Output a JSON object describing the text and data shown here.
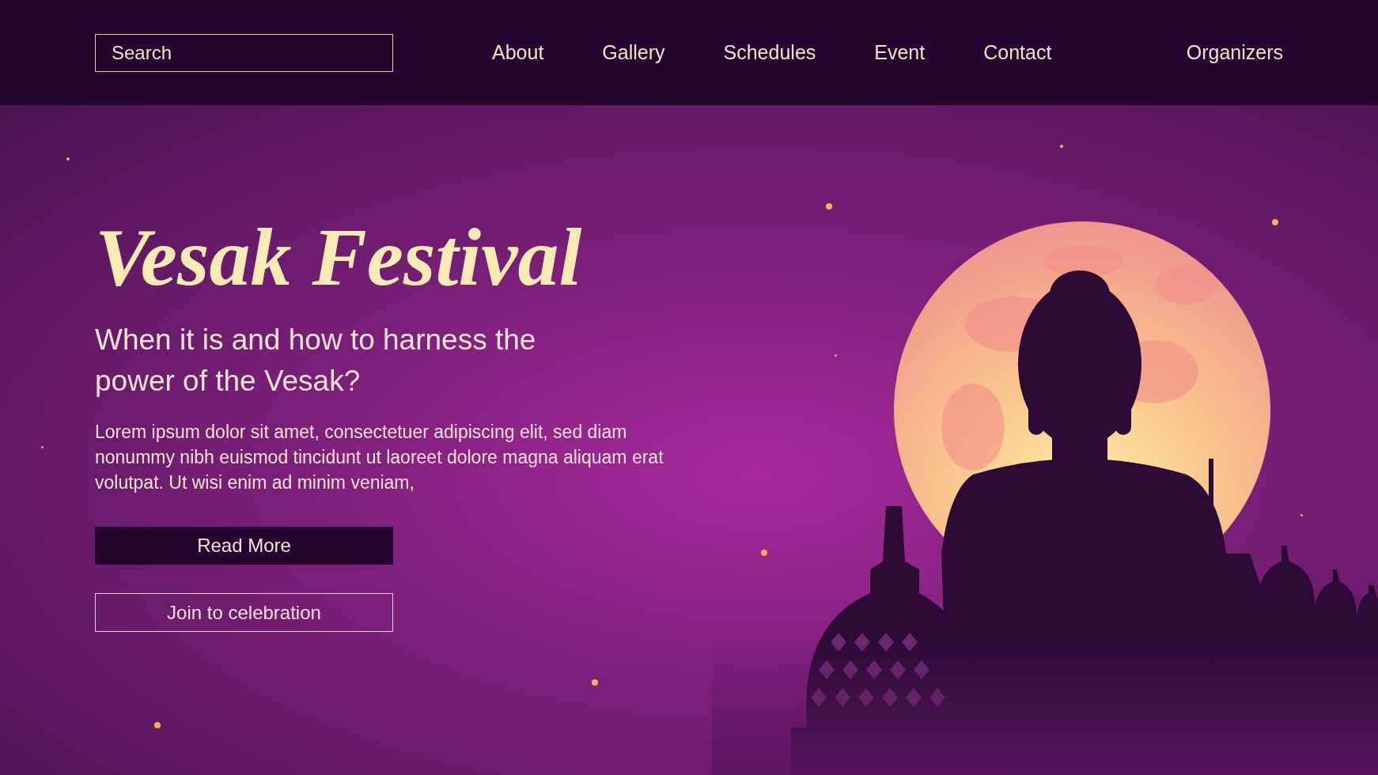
{
  "header": {
    "search": {
      "placeholder": "Search"
    },
    "nav": [
      {
        "label": "About"
      },
      {
        "label": "Gallery"
      },
      {
        "label": "Schedules"
      },
      {
        "label": "Event"
      },
      {
        "label": "Contact"
      },
      {
        "label": "Organizers"
      }
    ]
  },
  "hero": {
    "title": "Vesak Festival",
    "subtitle": "When it is and how to harness the power of the Vesak?",
    "body": "Lorem ipsum dolor sit amet, consectetuer adipiscing elit, sed diam nonummy nibh euismod tincidunt ut laoreet dolore magna aliquam erat volutpat. Ut wisi enim ad minim veniam,",
    "buttons": [
      {
        "label": "Read More",
        "kind": "filled"
      },
      {
        "label": "Join to celebration",
        "kind": "outline"
      }
    ]
  }
}
